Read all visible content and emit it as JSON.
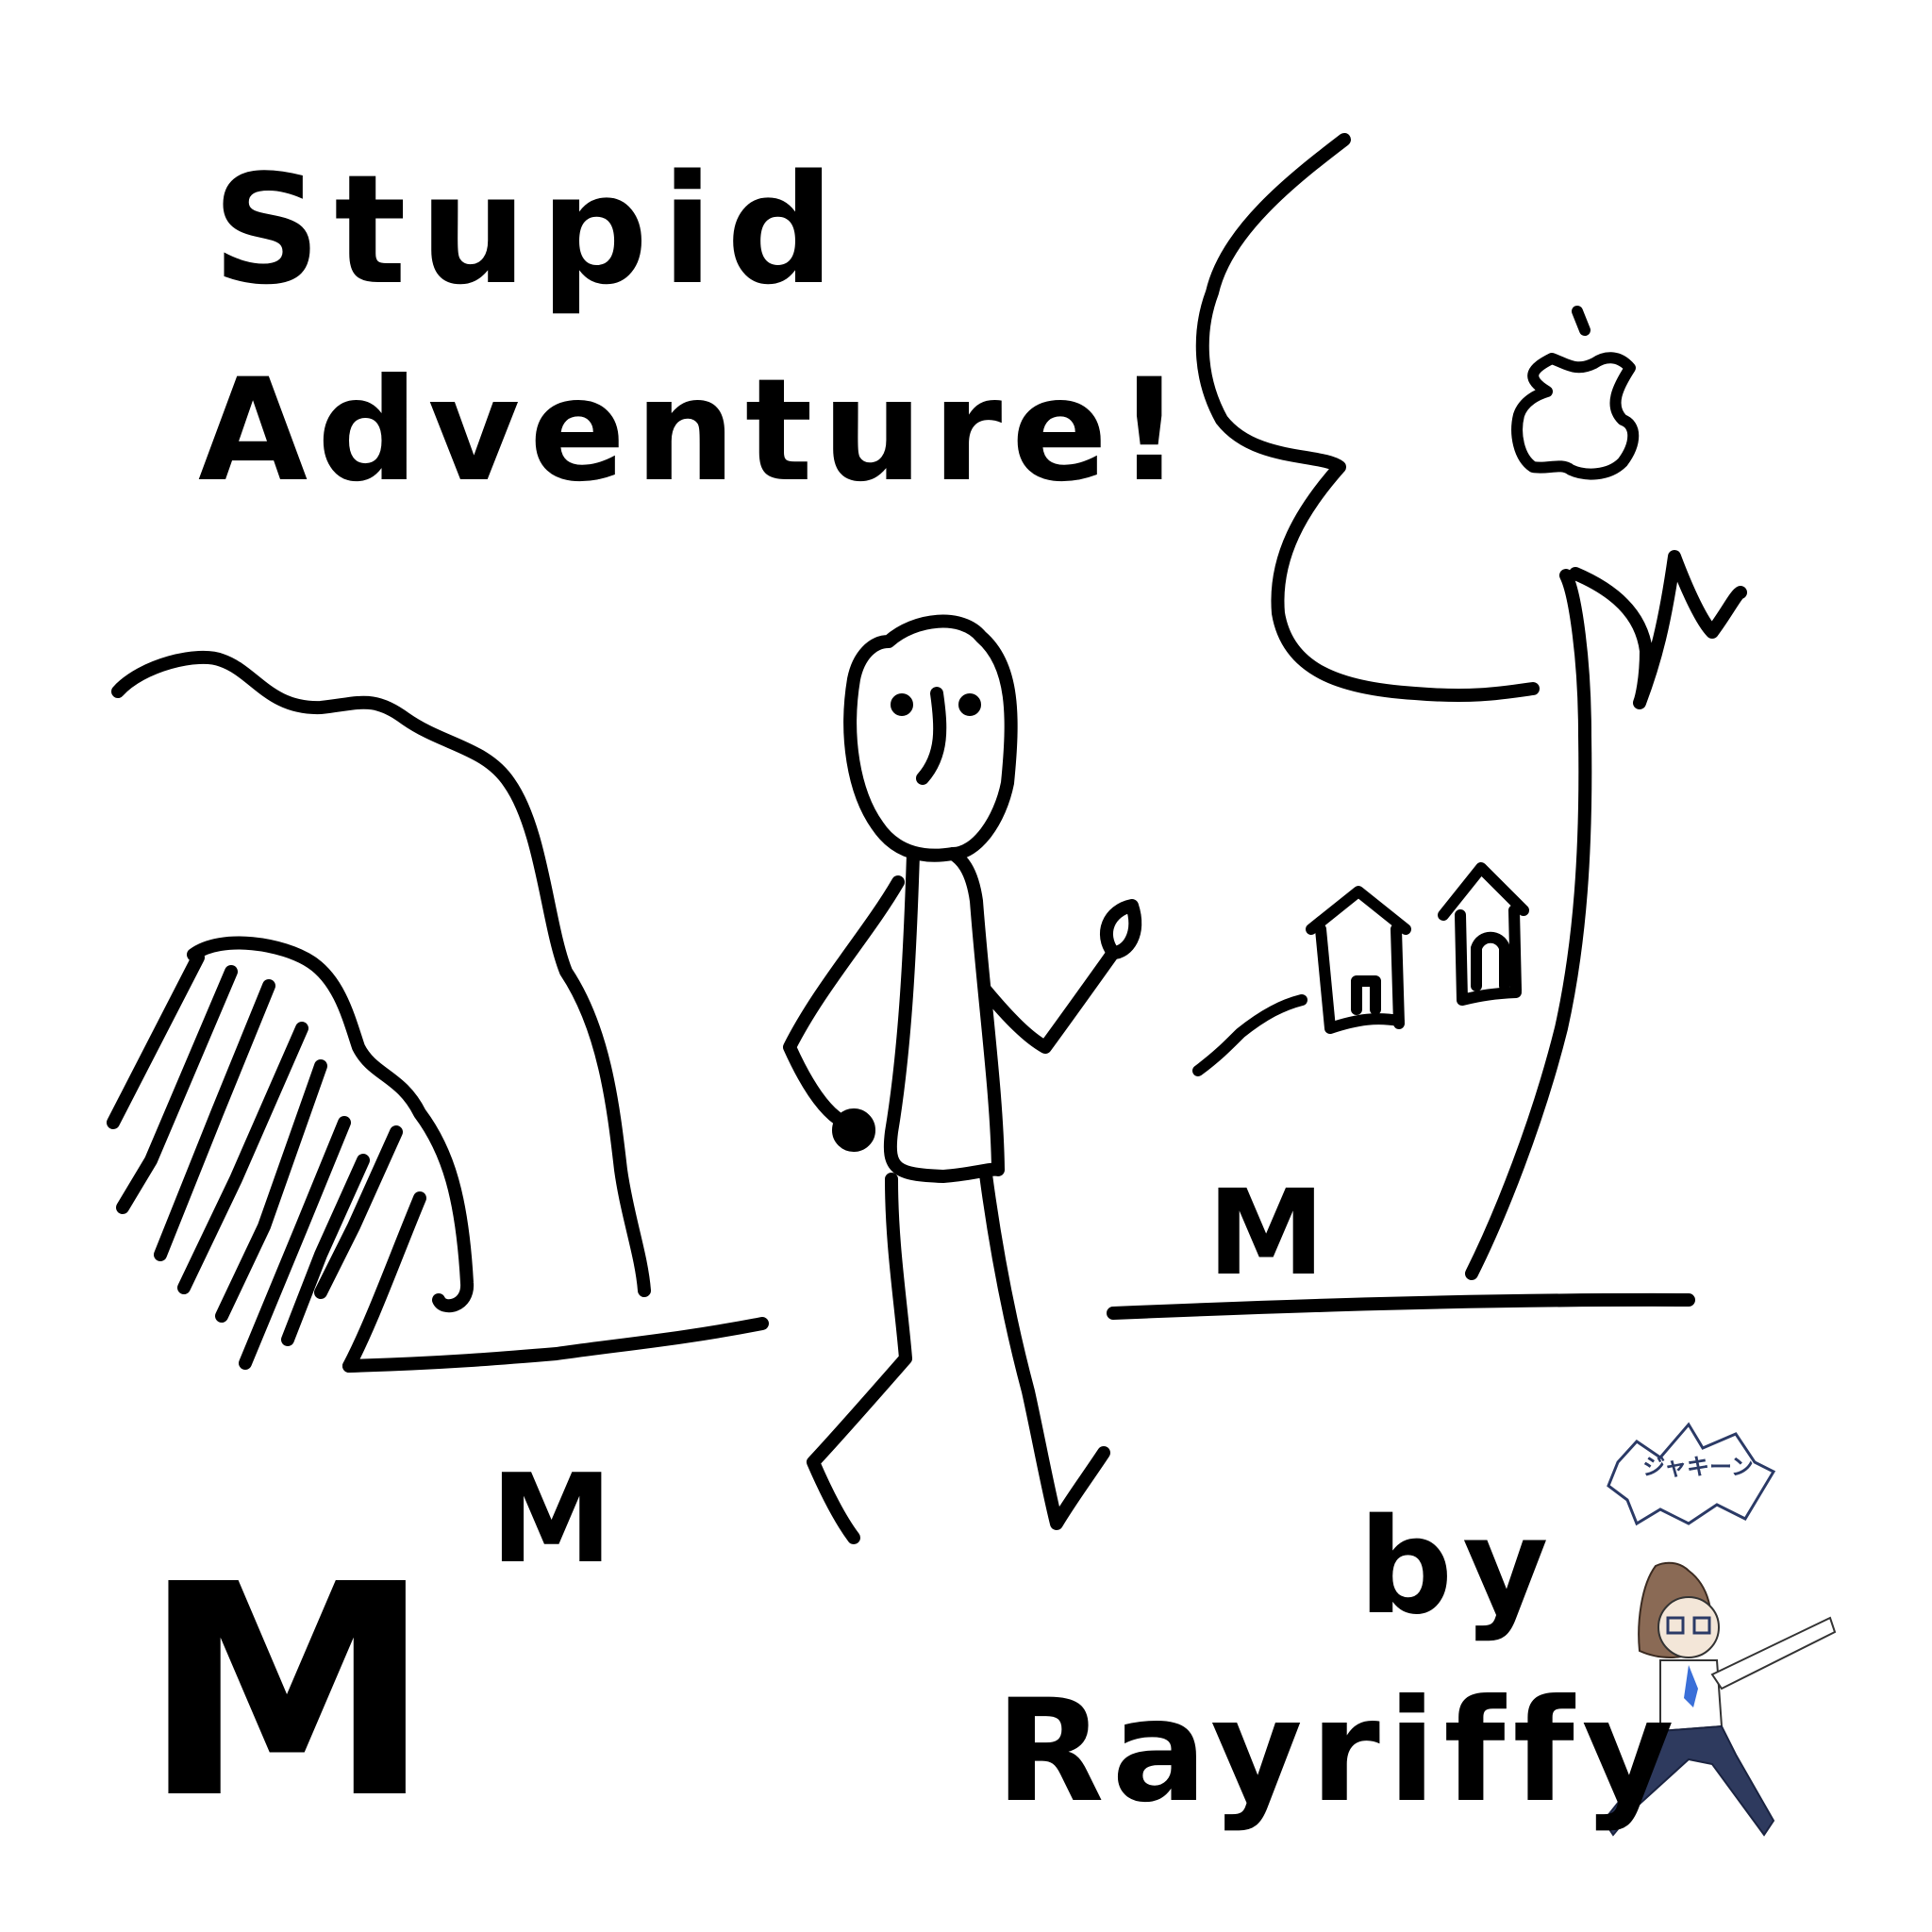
{
  "title": {
    "line1": "Stupid",
    "line2": "Adventure!"
  },
  "credit": {
    "by": "by",
    "author": "Rayriffy"
  },
  "marks": {
    "m_big": "M",
    "m_small": "M",
    "m_right": "M"
  },
  "avatar": {
    "sound_effect": "ジャキーン"
  },
  "colors": {
    "ink": "#000000",
    "background": "#ffffff",
    "avatar_hair": "#8a6a55",
    "avatar_pants": "#2e3a5e",
    "avatar_tie": "#3a6fd8",
    "sfx": "#2b3a66"
  }
}
